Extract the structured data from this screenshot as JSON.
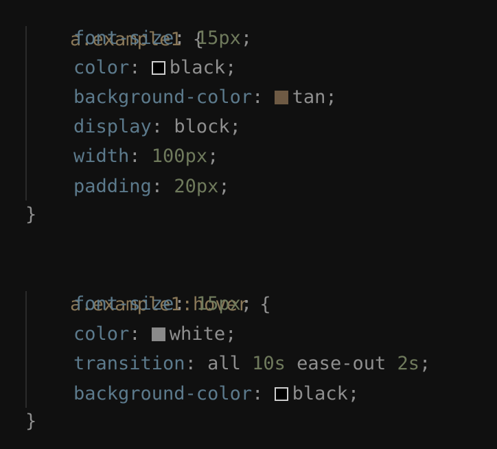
{
  "rules": [
    {
      "selector": "a.example1",
      "open": "{",
      "close": "}",
      "declarations": [
        {
          "property": "font-size",
          "value_num": "15px",
          "value_kw": ""
        },
        {
          "property": "color",
          "value_num": "",
          "value_kw": "black",
          "swatch": "#000000"
        },
        {
          "property": "background-color",
          "value_num": "",
          "value_kw": "tan",
          "swatch": "#6e5a44"
        },
        {
          "property": "display",
          "value_num": "",
          "value_kw": "block"
        },
        {
          "property": "width",
          "value_num": "100px",
          "value_kw": ""
        },
        {
          "property": "padding",
          "value_num": "20px",
          "value_kw": ""
        }
      ]
    },
    {
      "selector_base": "a.example1",
      "selector_pseudo": ":hover",
      "open": "{",
      "close": "}",
      "declarations": [
        {
          "property": "font-size",
          "value_num": "15px",
          "value_kw": ""
        },
        {
          "property": "color",
          "value_num": "",
          "value_kw": "white",
          "swatch": "#8a8a8a"
        },
        {
          "property": "transition",
          "value_parts": [
            "all",
            "10s",
            "ease-out",
            "2s"
          ]
        },
        {
          "property": "background-color",
          "value_num": "",
          "value_kw": "black",
          "swatch": "#000000"
        }
      ]
    }
  ]
}
